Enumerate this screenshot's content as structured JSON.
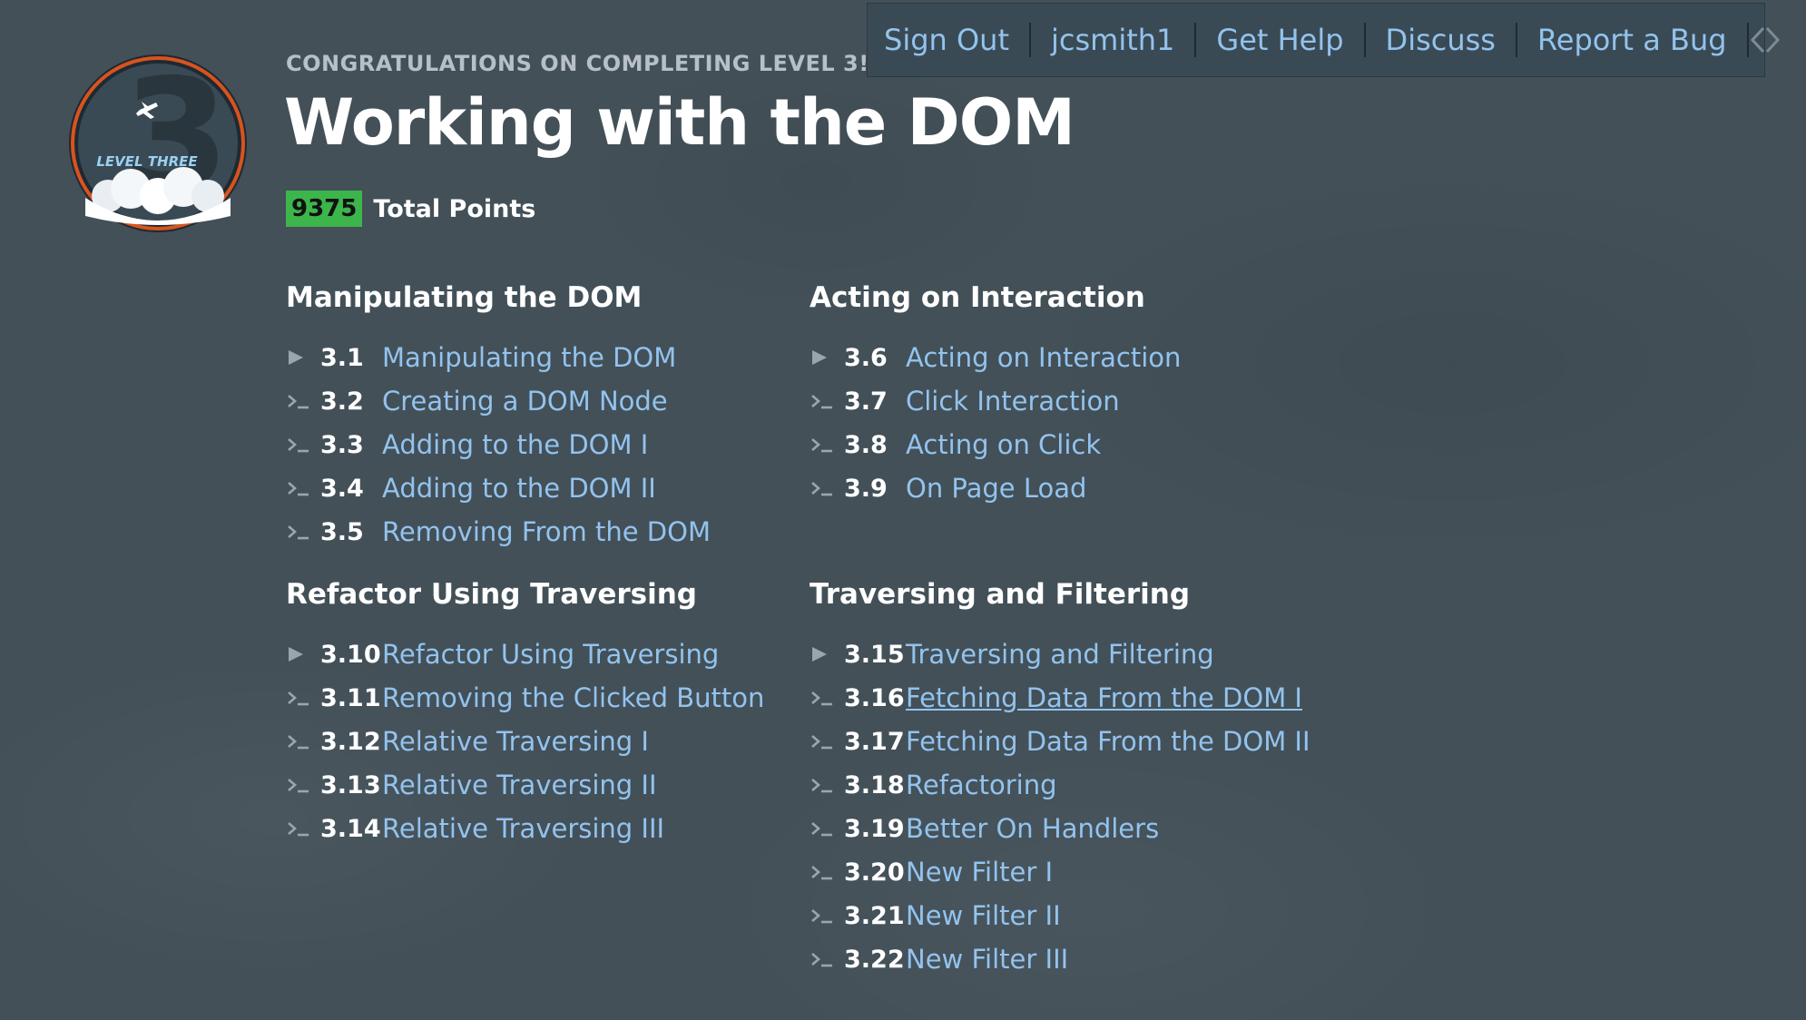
{
  "nav": {
    "links": [
      "Sign Out",
      "jcsmith1",
      "Get Help",
      "Discuss",
      "Report a Bug"
    ],
    "code_icon": "code-brackets-icon"
  },
  "badge": {
    "numeral": "3",
    "label": "LEVEL THREE",
    "icon": "airplane-icon"
  },
  "header": {
    "congrats": "CONGRATULATIONS ON COMPLETING LEVEL 3!",
    "title": "Working with the DOM",
    "points": "9375",
    "points_label": "Total Points"
  },
  "colors": {
    "background": "#435058",
    "link": "#93c3ee",
    "points_badge": "#3cb54a"
  },
  "sections": [
    {
      "title": "Manipulating the DOM",
      "items": [
        {
          "num": "3.1",
          "label": "Manipulating the DOM",
          "icon": "play-icon"
        },
        {
          "num": "3.2",
          "label": "Creating a DOM Node",
          "icon": "terminal-prompt-icon"
        },
        {
          "num": "3.3",
          "label": "Adding to the DOM I",
          "icon": "terminal-prompt-icon"
        },
        {
          "num": "3.4",
          "label": "Adding to the DOM II",
          "icon": "terminal-prompt-icon"
        },
        {
          "num": "3.5",
          "label": "Removing From the DOM",
          "icon": "terminal-prompt-icon"
        }
      ]
    },
    {
      "title": "Acting on Interaction",
      "items": [
        {
          "num": "3.6",
          "label": "Acting on Interaction",
          "icon": "play-icon"
        },
        {
          "num": "3.7",
          "label": "Click Interaction",
          "icon": "terminal-prompt-icon"
        },
        {
          "num": "3.8",
          "label": "Acting on Click",
          "icon": "terminal-prompt-icon"
        },
        {
          "num": "3.9",
          "label": "On Page Load",
          "icon": "terminal-prompt-icon"
        }
      ]
    },
    {
      "title": "Refactor Using Traversing",
      "items": [
        {
          "num": "3.10",
          "label": "Refactor Using Traversing",
          "icon": "play-icon"
        },
        {
          "num": "3.11",
          "label": "Removing the Clicked Button",
          "icon": "terminal-prompt-icon"
        },
        {
          "num": "3.12",
          "label": "Relative Traversing I",
          "icon": "terminal-prompt-icon"
        },
        {
          "num": "3.13",
          "label": "Relative Traversing II",
          "icon": "terminal-prompt-icon"
        },
        {
          "num": "3.14",
          "label": "Relative Traversing III",
          "icon": "terminal-prompt-icon"
        }
      ]
    },
    {
      "title": "Traversing and Filtering",
      "items": [
        {
          "num": "3.15",
          "label": "Traversing and Filtering",
          "icon": "play-icon"
        },
        {
          "num": "3.16",
          "label": "Fetching Data From the DOM I",
          "icon": "terminal-prompt-icon",
          "hover": true
        },
        {
          "num": "3.17",
          "label": "Fetching Data From the DOM II",
          "icon": "terminal-prompt-icon"
        },
        {
          "num": "3.18",
          "label": "Refactoring",
          "icon": "terminal-prompt-icon"
        },
        {
          "num": "3.19",
          "label": "Better On Handlers",
          "icon": "terminal-prompt-icon"
        },
        {
          "num": "3.20",
          "label": "New Filter I",
          "icon": "terminal-prompt-icon"
        },
        {
          "num": "3.21",
          "label": "New Filter II",
          "icon": "terminal-prompt-icon"
        },
        {
          "num": "3.22",
          "label": "New Filter III",
          "icon": "terminal-prompt-icon"
        }
      ]
    }
  ]
}
